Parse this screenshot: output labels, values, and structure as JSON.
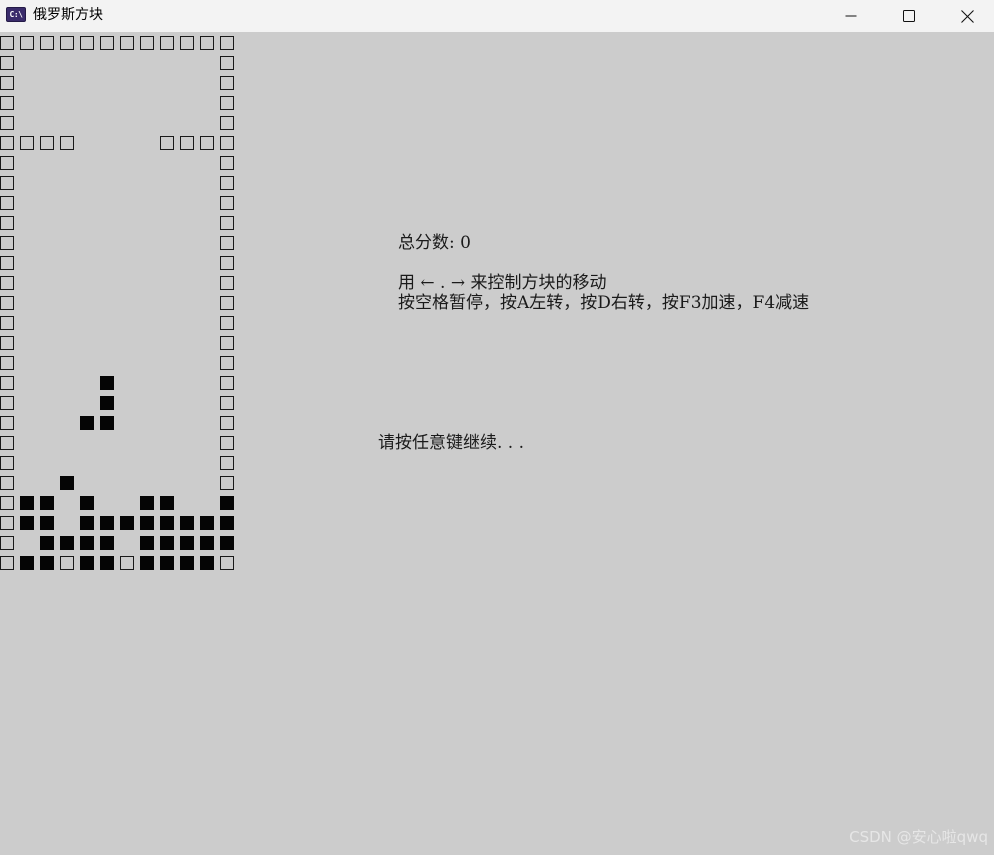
{
  "window": {
    "title": "俄罗斯方块",
    "icon": "console-app-icon",
    "icon_text": "C:\\",
    "controls": [
      "minimize-icon",
      "maximize-icon",
      "close-icon"
    ]
  },
  "board": {
    "columns": 12,
    "rows": 27,
    "wall_rows": [
      "############",
      "#          #",
      "#          #",
      "#          #",
      "#          #",
      "####    ####",
      "#          #",
      "#          #",
      "#          #",
      "#          #",
      "#          #",
      "#          #",
      "#          #",
      "#          #",
      "#          #",
      "#          #",
      "#          #",
      "#          #",
      "#          #",
      "#          #",
      "#          #",
      "#          #",
      "#          #",
      "#          #",
      "#          #",
      "#          #",
      "############"
    ],
    "block_rows": [
      "............",
      "............",
      "............",
      "............",
      "............",
      "............",
      "............",
      "............",
      "............",
      "............",
      "............",
      "............",
      "............",
      "............",
      "............",
      "............",
      "............",
      ".....X......",
      ".....X......",
      "....XX......",
      "............",
      "............",
      "...X........",
      ".XX.X..XX..X",
      ".XX.XXXXXXXX",
      "..XXXX.XXXXX",
      ".XX.XX.XXXX.",
      "............"
    ]
  },
  "info": {
    "score_label": "总分数: 0",
    "controls_text": "用 ← . → 来控制方块的移动",
    "keys_text": "按空格暂停，按A左转，按D右转，按F3加速，F4减速",
    "continue_text": "请按任意键继续. . ."
  },
  "watermark": "CSDN @安心啦qwq",
  "colors": {
    "background": "#cccccc",
    "block": "#050505",
    "titlebar": "#f3f3f3"
  }
}
